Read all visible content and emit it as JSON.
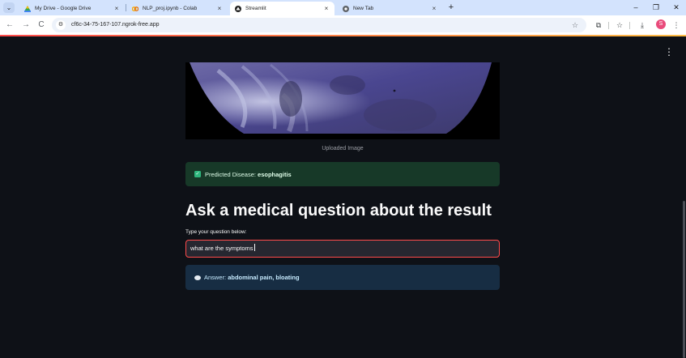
{
  "browser": {
    "tabs": [
      {
        "title": "My Drive - Google Drive",
        "icon": "google-drive-icon",
        "active": false
      },
      {
        "title": "NLP_proj.ipynb - Colab",
        "icon": "colab-icon",
        "active": false
      },
      {
        "title": "Streamlit",
        "icon": "streamlit-icon",
        "active": true
      },
      {
        "title": "New Tab",
        "icon": "chrome-icon",
        "active": false
      }
    ],
    "url": "cf6c-34-75-167-107.ngrok-free.app"
  },
  "app": {
    "image_caption": "Uploaded Image",
    "prediction": {
      "label": "Predicted Disease:",
      "value": "esophagitis"
    },
    "heading": "Ask a medical question about the result",
    "question": {
      "label": "Type your question below:",
      "value": "what are the symptoms"
    },
    "answer": {
      "label": "Answer:",
      "value": "abdominal pain, bloating"
    }
  },
  "colors": {
    "background": "#0e1117",
    "success_bg": "#173928",
    "info_bg": "#172d43",
    "accent": "#ff4b4b"
  }
}
